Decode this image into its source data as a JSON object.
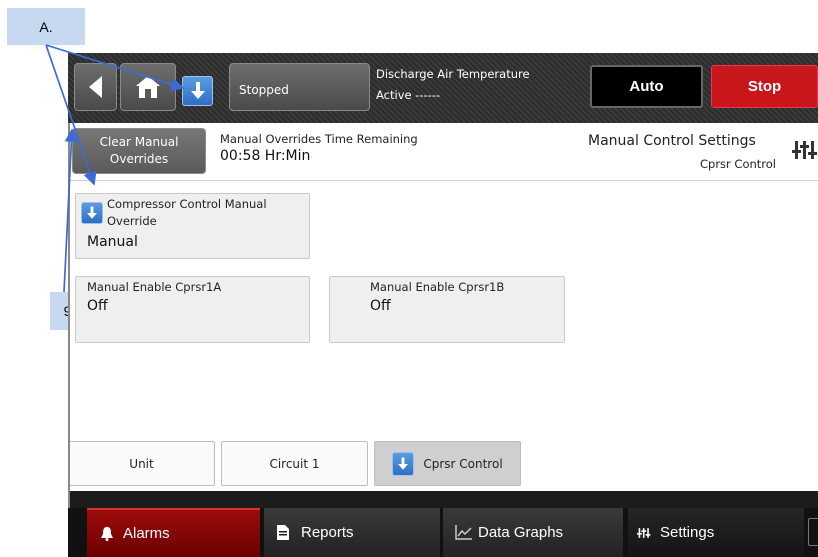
{
  "annotations": {
    "callout_a": "A.",
    "callout_9": "9"
  },
  "topbar": {
    "status_button": "Stopped",
    "discharge_label": "Discharge Air Temperature",
    "active_label": "Active",
    "active_value": "------",
    "auto_button": "Auto",
    "stop_button": "Stop"
  },
  "overrides": {
    "clear_button_line1": "Clear Manual",
    "clear_button_line2": "Overrides",
    "time_label": "Manual Overrides Time Remaining",
    "time_value": "00:58 Hr:Min",
    "settings_title": "Manual Control Settings",
    "settings_sub": "Cprsr Control"
  },
  "cards": {
    "compressor": {
      "label_line1": "Compressor Control Manual",
      "label_line2": "Override",
      "value": "Manual"
    },
    "cprsr1a": {
      "label": "Manual Enable Cprsr1A",
      "value": "Off"
    },
    "cprsr1b": {
      "label": "Manual Enable Cprsr1B",
      "value": "Off"
    }
  },
  "tabs": [
    "Unit",
    "Circuit 1",
    "Cprsr Control"
  ],
  "nav": {
    "alarms": "Alarms",
    "reports": "Reports",
    "graphs": "Data Graphs",
    "settings": "Settings"
  },
  "colors": {
    "alarm_red": "#8b0000",
    "stop_red": "#c8161b",
    "blue_button": "#3b7fd4"
  }
}
